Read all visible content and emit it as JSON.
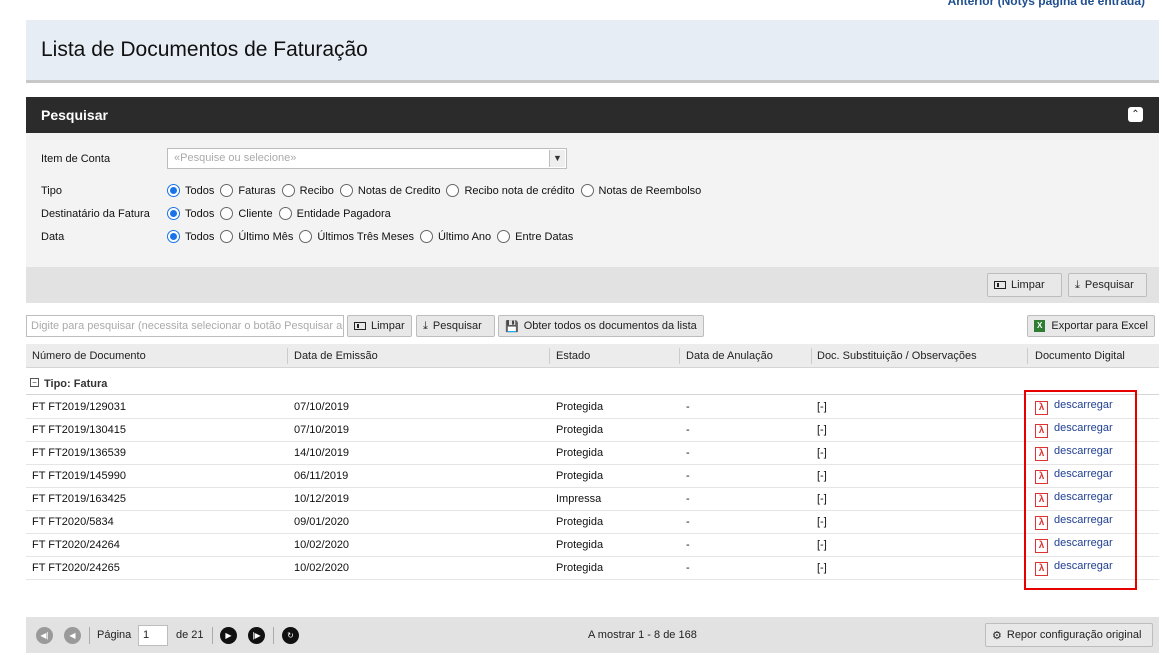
{
  "top_link": "Anterior (Notys página de entrada)",
  "page_title": "Lista de Documentos de Faturação",
  "search_panel": {
    "title": "Pesquisar",
    "item_conta_label": "Item de Conta",
    "item_conta_placeholder": "«Pesquise ou selecione»",
    "tipo_label": "Tipo",
    "tipo_options": [
      "Todos",
      "Faturas",
      "Recibo",
      "Notas de Credito",
      "Recibo nota de crédito",
      "Notas de Reembolso"
    ],
    "destinatario_label": "Destinatário da Fatura",
    "destinatario_options": [
      "Todos",
      "Cliente",
      "Entidade Pagadora"
    ],
    "data_label": "Data",
    "data_options": [
      "Todos",
      "Último Mês",
      "Últimos Três Meses",
      "Último Ano",
      "Entre Datas"
    ],
    "clear_label": "Limpar",
    "search_label": "Pesquisar"
  },
  "grid_toolbar": {
    "search_placeholder": "Digite para pesquisar (necessita selecionar o botão Pesquisar após)",
    "clear_label": "Limpar",
    "search_label": "Pesquisar",
    "get_all_label": "Obter todos os documentos da lista",
    "export_label": "Exportar para Excel"
  },
  "table": {
    "columns": [
      "Número de Documento",
      "Data de Emissão",
      "Estado",
      "Data de Anulação",
      "Doc. Substituição / Observações",
      "Documento Digital"
    ],
    "group_label": "Tipo: Fatura",
    "rows": [
      {
        "numero": "FT FT2019/129031",
        "data": "07/10/2019",
        "estado": "Protegida",
        "anulacao": "-",
        "obs": "[-]",
        "link": "descarregar"
      },
      {
        "numero": "FT FT2019/130415",
        "data": "07/10/2019",
        "estado": "Protegida",
        "anulacao": "-",
        "obs": "[-]",
        "link": "descarregar"
      },
      {
        "numero": "FT FT2019/136539",
        "data": "14/10/2019",
        "estado": "Protegida",
        "anulacao": "-",
        "obs": "[-]",
        "link": "descarregar"
      },
      {
        "numero": "FT FT2019/145990",
        "data": "06/11/2019",
        "estado": "Protegida",
        "anulacao": "-",
        "obs": "[-]",
        "link": "descarregar"
      },
      {
        "numero": "FT FT2019/163425",
        "data": "10/12/2019",
        "estado": "Impressa",
        "anulacao": "-",
        "obs": "[-]",
        "link": "descarregar"
      },
      {
        "numero": "FT FT2020/5834",
        "data": "09/01/2020",
        "estado": "Protegida",
        "anulacao": "-",
        "obs": "[-]",
        "link": "descarregar"
      },
      {
        "numero": "FT FT2020/24264",
        "data": "10/02/2020",
        "estado": "Protegida",
        "anulacao": "-",
        "obs": "[-]",
        "link": "descarregar"
      },
      {
        "numero": "FT FT2020/24265",
        "data": "10/02/2020",
        "estado": "Protegida",
        "anulacao": "-",
        "obs": "[-]",
        "link": "descarregar"
      }
    ]
  },
  "pager": {
    "page_label": "Página",
    "page_value": "1",
    "of_label": "de 21",
    "showing": "A mostrar 1 - 8 de 168",
    "reset_label": "Repor configuração original"
  },
  "colors": {
    "header_bg": "#2b2b2b",
    "title_bg": "#e6edf5",
    "radio_accent": "#1a73e8",
    "highlight": "#e60000",
    "link": "#1f3f8f"
  }
}
